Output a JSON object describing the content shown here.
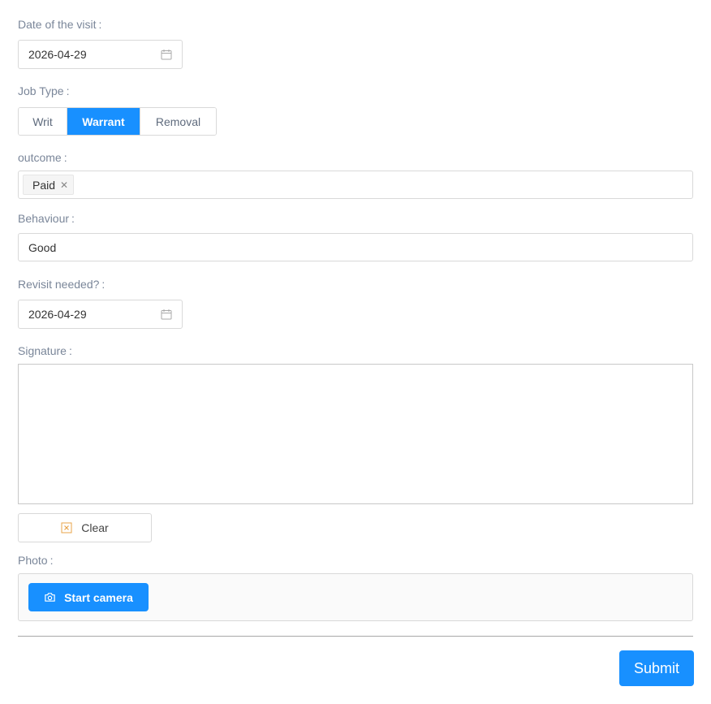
{
  "visit_date": {
    "label": "Date of the visit",
    "value": "2026-04-29"
  },
  "job_type": {
    "label": "Job Type",
    "options": [
      "Writ",
      "Warrant",
      "Removal"
    ],
    "selected": "Warrant"
  },
  "outcome": {
    "label": "outcome",
    "tags": [
      "Paid"
    ]
  },
  "behaviour": {
    "label": "Behaviour",
    "value": "Good"
  },
  "revisit": {
    "label": "Revisit needed?",
    "value": "2026-04-29"
  },
  "signature": {
    "label": "Signature",
    "clear_label": "Clear"
  },
  "photo": {
    "label": "Photo",
    "start_camera_label": "Start camera"
  },
  "submit_label": "Submit",
  "label_separator": ":",
  "colors": {
    "primary": "#1890ff",
    "label": "#7a8699",
    "border": "#d9d9d9",
    "clear_icon": "#e8a44a"
  },
  "icons": {
    "date": "calendar-icon",
    "tag_remove": "close-icon",
    "clear": "clear-x-icon",
    "camera": "camera-icon"
  }
}
